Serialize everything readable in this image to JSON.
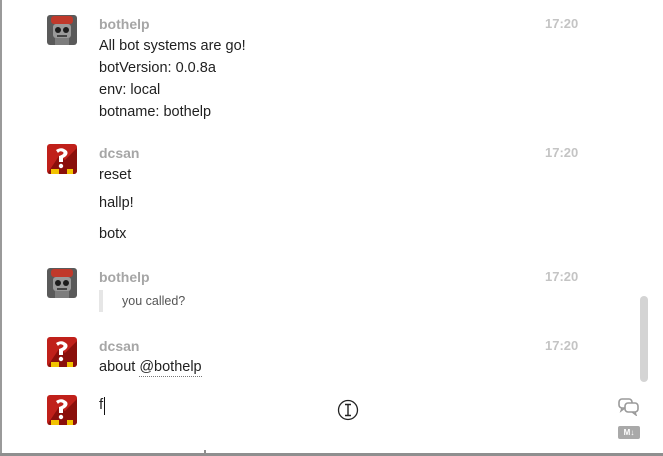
{
  "messages": [
    {
      "user": "bothelp",
      "time": "17:20",
      "avatar": "robot-avatar-icon",
      "lines": [
        "All bot systems are go!",
        "botVersion: 0.0.8a",
        "env: local",
        "botname: bothelp"
      ]
    },
    {
      "user": "dcsan",
      "time": "17:20",
      "avatar": "dcsan-avatar-icon",
      "lines": [
        "reset",
        "hallp!",
        "botx"
      ]
    },
    {
      "user": "bothelp",
      "time": "17:20",
      "avatar": "robot-avatar-icon",
      "quote": "you called?"
    },
    {
      "user": "dcsan",
      "time": "17:20",
      "avatar": "dcsan-avatar-icon",
      "text_prefix": "about ",
      "mention": "@bothelp"
    }
  ],
  "composer": {
    "value": "f",
    "avatar": "dcsan-avatar-icon",
    "chat_icon": "chat-bubbles-icon",
    "markdown_icon": "markdown-icon",
    "markdown_label": "M↓"
  },
  "colors": {
    "username": "#a6a6a6",
    "timestamp": "#c4c4c4",
    "text": "#1f1f1f",
    "quote_bar": "#e6e6e6",
    "scrollbar": "#d4d4d4"
  }
}
